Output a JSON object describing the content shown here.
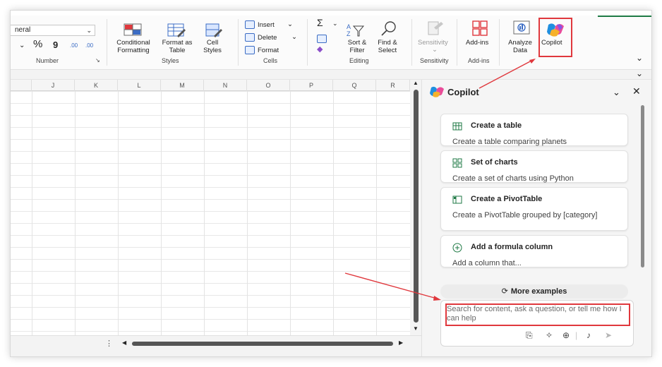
{
  "ribbon": {
    "number": {
      "format_value": "neral",
      "percent_symbol": "%",
      "comma_symbol": "9",
      "increase_decimals": ".00",
      "decrease_decimals": ".00",
      "group_label": "Number"
    },
    "styles": {
      "conditional_formatting_label": "Conditional Formatting",
      "format_as_table_label": "Format as Table",
      "cell_styles_label": "Cell Styles",
      "group_label": "Styles"
    },
    "cells": {
      "insert_label": "Insert",
      "delete_label": "Delete",
      "format_label": "Format",
      "group_label": "Cells"
    },
    "editing": {
      "sort_filter_label": "Sort & Filter",
      "find_select_label": "Find & Select",
      "group_label": "Editing"
    },
    "sensitivity": {
      "button_label": "Sensitivity",
      "group_label": "Sensitivity"
    },
    "addins": {
      "button_label": "Add-ins",
      "group_label": "Add-ins"
    },
    "analyze_data_label": "Analyze Data",
    "copilot_label": "Copilot"
  },
  "sheet": {
    "columns": [
      "J",
      "K",
      "L",
      "M",
      "N",
      "O",
      "P",
      "Q",
      "R"
    ]
  },
  "copilot_pane": {
    "title": "Copilot",
    "cards": [
      {
        "icon": "table-icon",
        "title": "Create a table",
        "description": "Create a table comparing planets"
      },
      {
        "icon": "charts-icon",
        "title": "Set of charts",
        "description": "Create a set of charts using Python"
      },
      {
        "icon": "pivot-table-icon",
        "title": "Create a PivotTable",
        "description": "Create a PivotTable grouped by [category]"
      },
      {
        "icon": "plus-circle-icon",
        "title": "Add a formula column",
        "description": "Add a column that..."
      }
    ],
    "more_examples_label": "More examples",
    "chat_placeholder": "Search for content, ask a question, or tell me how I can help"
  },
  "colors": {
    "highlight": "#e0383d",
    "excel_green": "#1f7a45",
    "accent_blue": "#3b6cc4"
  }
}
